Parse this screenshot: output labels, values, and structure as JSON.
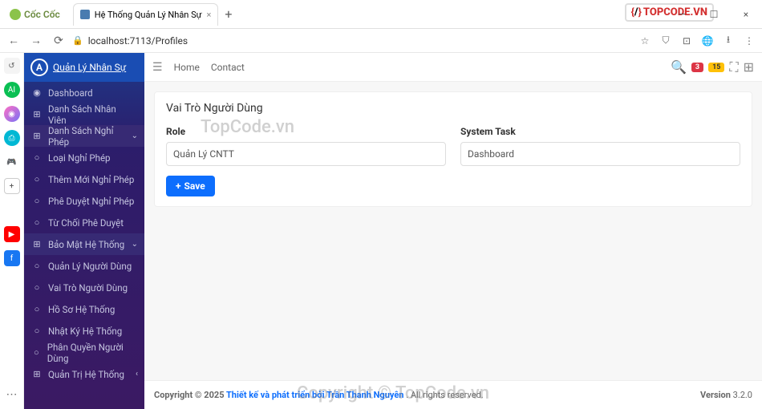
{
  "browser": {
    "name": "Cốc Cốc",
    "tab_title": "Hệ Thống Quản Lý Nhân Sự",
    "url": "localhost:7113/Profiles",
    "topcode": "TOPCODE.VN"
  },
  "sidebar": {
    "brand": "Quản Lý Nhân Sự",
    "items": [
      {
        "label": "Dashboard",
        "icon": "◉"
      },
      {
        "label": "Danh Sách Nhân Viên",
        "icon": "⊞"
      },
      {
        "label": "Danh Sách Nghỉ Phép",
        "icon": "⊞",
        "active": true,
        "chev": "⌄"
      },
      {
        "label": "Loại Nghỉ Phép",
        "icon": "○"
      },
      {
        "label": "Thêm Mới Nghỉ Phép",
        "icon": "○"
      },
      {
        "label": "Phê Duyệt Nghỉ Phép",
        "icon": "○"
      },
      {
        "label": "Từ Chối Phê Duyệt",
        "icon": "○"
      },
      {
        "label": "Bảo Mật Hệ Thống",
        "icon": "⊞",
        "active": true,
        "chev": "⌄"
      },
      {
        "label": "Quản Lý Người Dùng",
        "icon": "○"
      },
      {
        "label": "Vai Trò Người Dùng",
        "icon": "○"
      },
      {
        "label": "Hồ Sơ Hệ Thống",
        "icon": "○"
      },
      {
        "label": "Nhật Ký Hệ Thống",
        "icon": "○"
      },
      {
        "label": "Phân Quyền Người Dùng",
        "icon": "○"
      },
      {
        "label": "Quản Trị Hệ Thống",
        "icon": "⊞",
        "chev": "‹"
      }
    ]
  },
  "topbar": {
    "home": "Home",
    "contact": "Contact",
    "badge_red": "3",
    "badge_yel": "15"
  },
  "card": {
    "title": "Vai Trò Người Dùng",
    "role_label": "Role",
    "role_value": "Quản Lý CNTT",
    "task_label": "System Task",
    "task_value": "Dashboard",
    "save": "Save"
  },
  "footer": {
    "copyright": "Copyright © 2025 ",
    "link": "Thiết kế và phát triển bởi Trần Thanh Nguyên",
    "rights": ". All rights reserved.",
    "version_label": "Version ",
    "version": "3.2.0"
  },
  "watermark": "TopCode.vn",
  "watermark2": "Copyright © TopCode.vn"
}
